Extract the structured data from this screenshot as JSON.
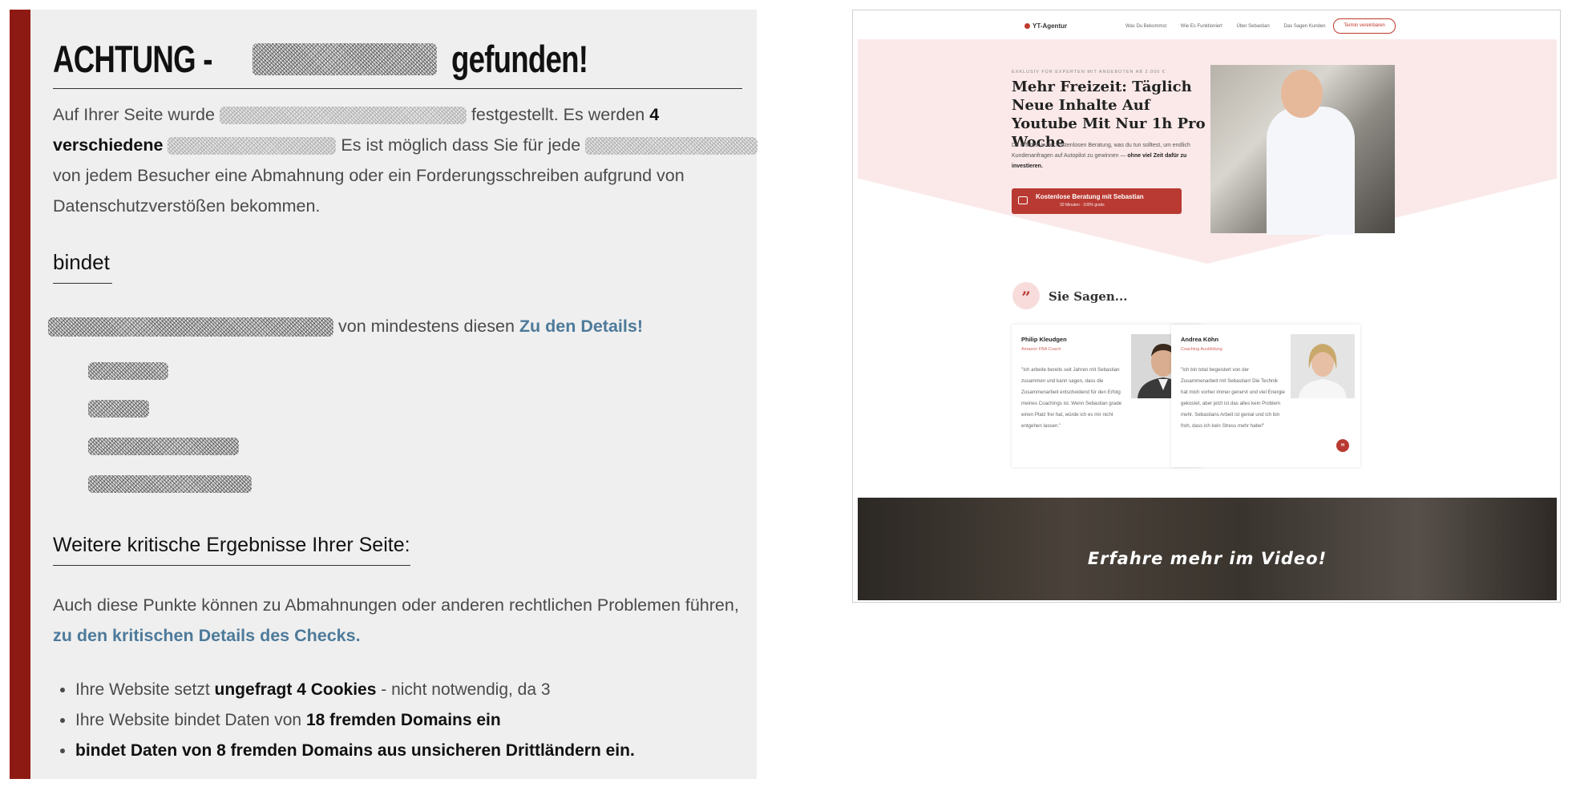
{
  "report": {
    "headline_prefix": "ACHTUNG -",
    "headline_suffix": "gefunden!",
    "para1_a": "Auf Ihrer Seite wurde",
    "para1_b": "festgestellt. Es werden",
    "para1_count": "4",
    "para1_c": "verschiedene",
    "para1_d": "Es ist möglich dass Sie für jede",
    "para1_e": "von jedem Besucher eine Abmahnung oder ein Forderungsschreiben aufgrund von Datenschutzverstößen bekommen.",
    "bindet_heading": "bindet",
    "bindet_line_text": "von mindestens diesen",
    "bindet_link": "Zu den Details!",
    "weitere_heading": "Weitere kritische Ergebnisse Ihrer Seite:",
    "weitere_text": "Auch diese Punkte können zu Abmahnungen oder anderen rechtlichen Problemen führen,",
    "weitere_link": "zu den kritischen Details des Checks.",
    "bullets": [
      {
        "a": "Ihre Website setzt",
        "b": "ungefragt 4 Cookies",
        "c": "- nicht notwendig, da 3"
      },
      {
        "a": "Ihre Website bindet Daten von",
        "b": "18 fremden Domains ein",
        "c": ""
      },
      {
        "a": "",
        "b": "bindet Daten von 8 fremden Domains aus unsicheren Drittländern ein.",
        "c": ""
      }
    ]
  },
  "site": {
    "logo": "YT-Agentur",
    "nav": [
      "Was Du Bekommst",
      "Wie Es Funktioniert",
      "Über Sebastian",
      "Das Sagen Kunden"
    ],
    "nav_button": "Termin vereinbaren",
    "hero_kicker": "EXKLUSIV FÜR EXPERTEN MIT ANGEBOTEN AB 2.000 €",
    "hero_title": "Mehr Freizeit: Täglich Neue Inhalte Auf Youtube Mit Nur 1h Pro Woche",
    "hero_text_a": "Du erfährst in der kostenlosen Beratung, was du tun solltest, um endlich Kundenanfragen auf Autopilot zu gewinnen —",
    "hero_text_b": "ohne viel Zeit dafür zu investieren.",
    "cta_main": "Kostenlose Beratung mit Sebastian",
    "cta_sub": "30 Minuten · 100% gratis",
    "testimonials_title": "Sie Sagen...",
    "testimonials": [
      {
        "name": "Philip Kleudgen",
        "role": "Amazon FBA Coach",
        "text": "\"Ich arbeite bereits seit Jahren mit Sebastian zusammen und kann sagen, dass die Zusammenarbeit entscheidend für den Erfolg meines Coachings ist. Wenn Sebastian grade einen Platz frei hat, würde ich es mir nicht entgehen lassen.\""
      },
      {
        "name": "Andrea Köhn",
        "role": "Coaching Ausbildung",
        "text": "\"Ich bin total begeistert von der Zusammenarbeit mit Sebastian! Die Technik hat mich vorher immer genervt und viel Energie gekostet, aber jetzt ist das alles kein Problem mehr. Sebastians Arbeit ist genial und ich bin froh, dass ich kein Stress mehr habe!\""
      }
    ],
    "video_caption": "Erfahre mehr im Video!"
  },
  "colors": {
    "accent": "#8e1a14",
    "link": "#4d7a9a",
    "cta": "#b93a32"
  }
}
